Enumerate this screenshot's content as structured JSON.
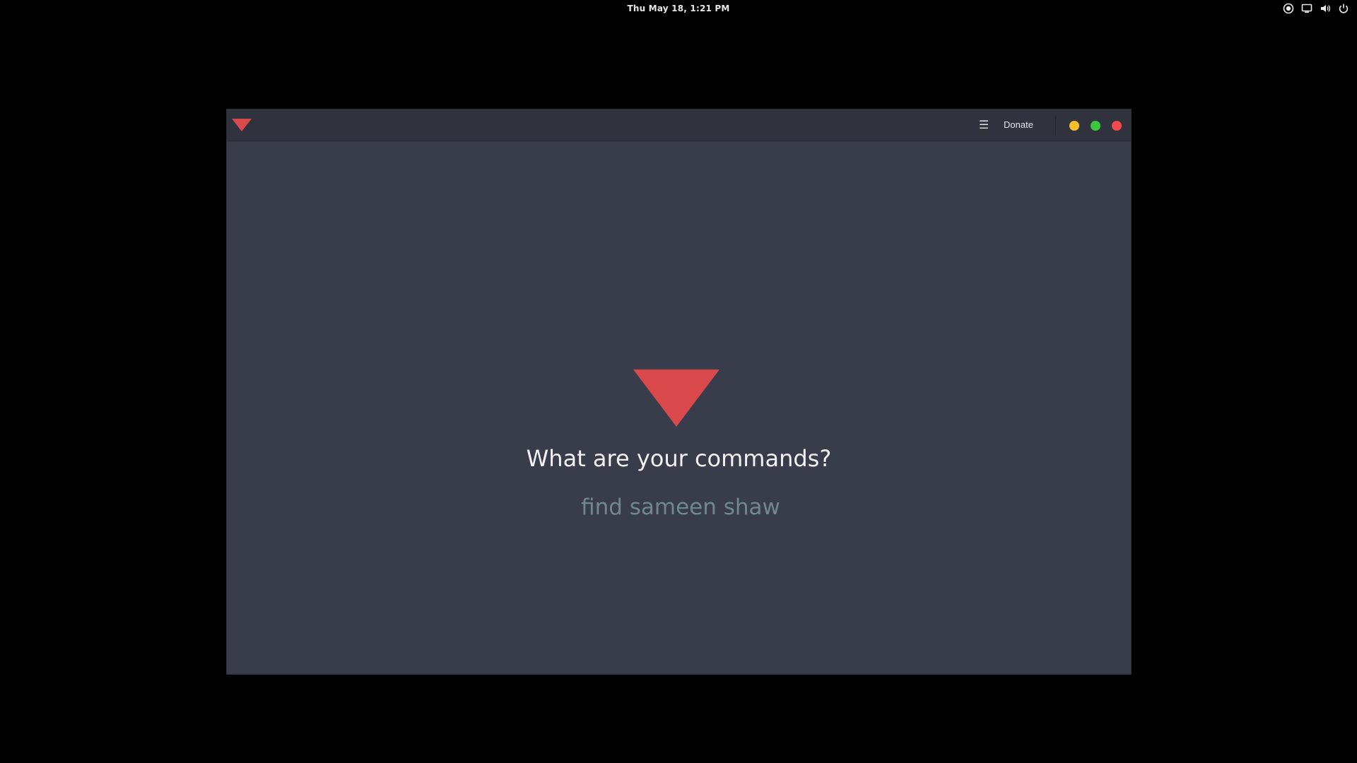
{
  "system_bar": {
    "clock": "Thu May 18,  1:21 PM",
    "tray_icons": [
      "screen-record-icon",
      "display-icon",
      "volume-icon",
      "power-icon"
    ]
  },
  "window": {
    "menu_icon": "☰",
    "donate_label": "Donate",
    "controls": {
      "minimize_color": "#f5bf2a",
      "maximize_color": "#3bc63b",
      "close_color": "#f24a4a"
    }
  },
  "main": {
    "headline": "What are your commands?",
    "command_value": "find sameen shaw"
  },
  "colors": {
    "accent": "#d9484b",
    "window_bg": "#393c4b",
    "titlebar_bg": "#30323e",
    "input_text": "#6e8790"
  }
}
